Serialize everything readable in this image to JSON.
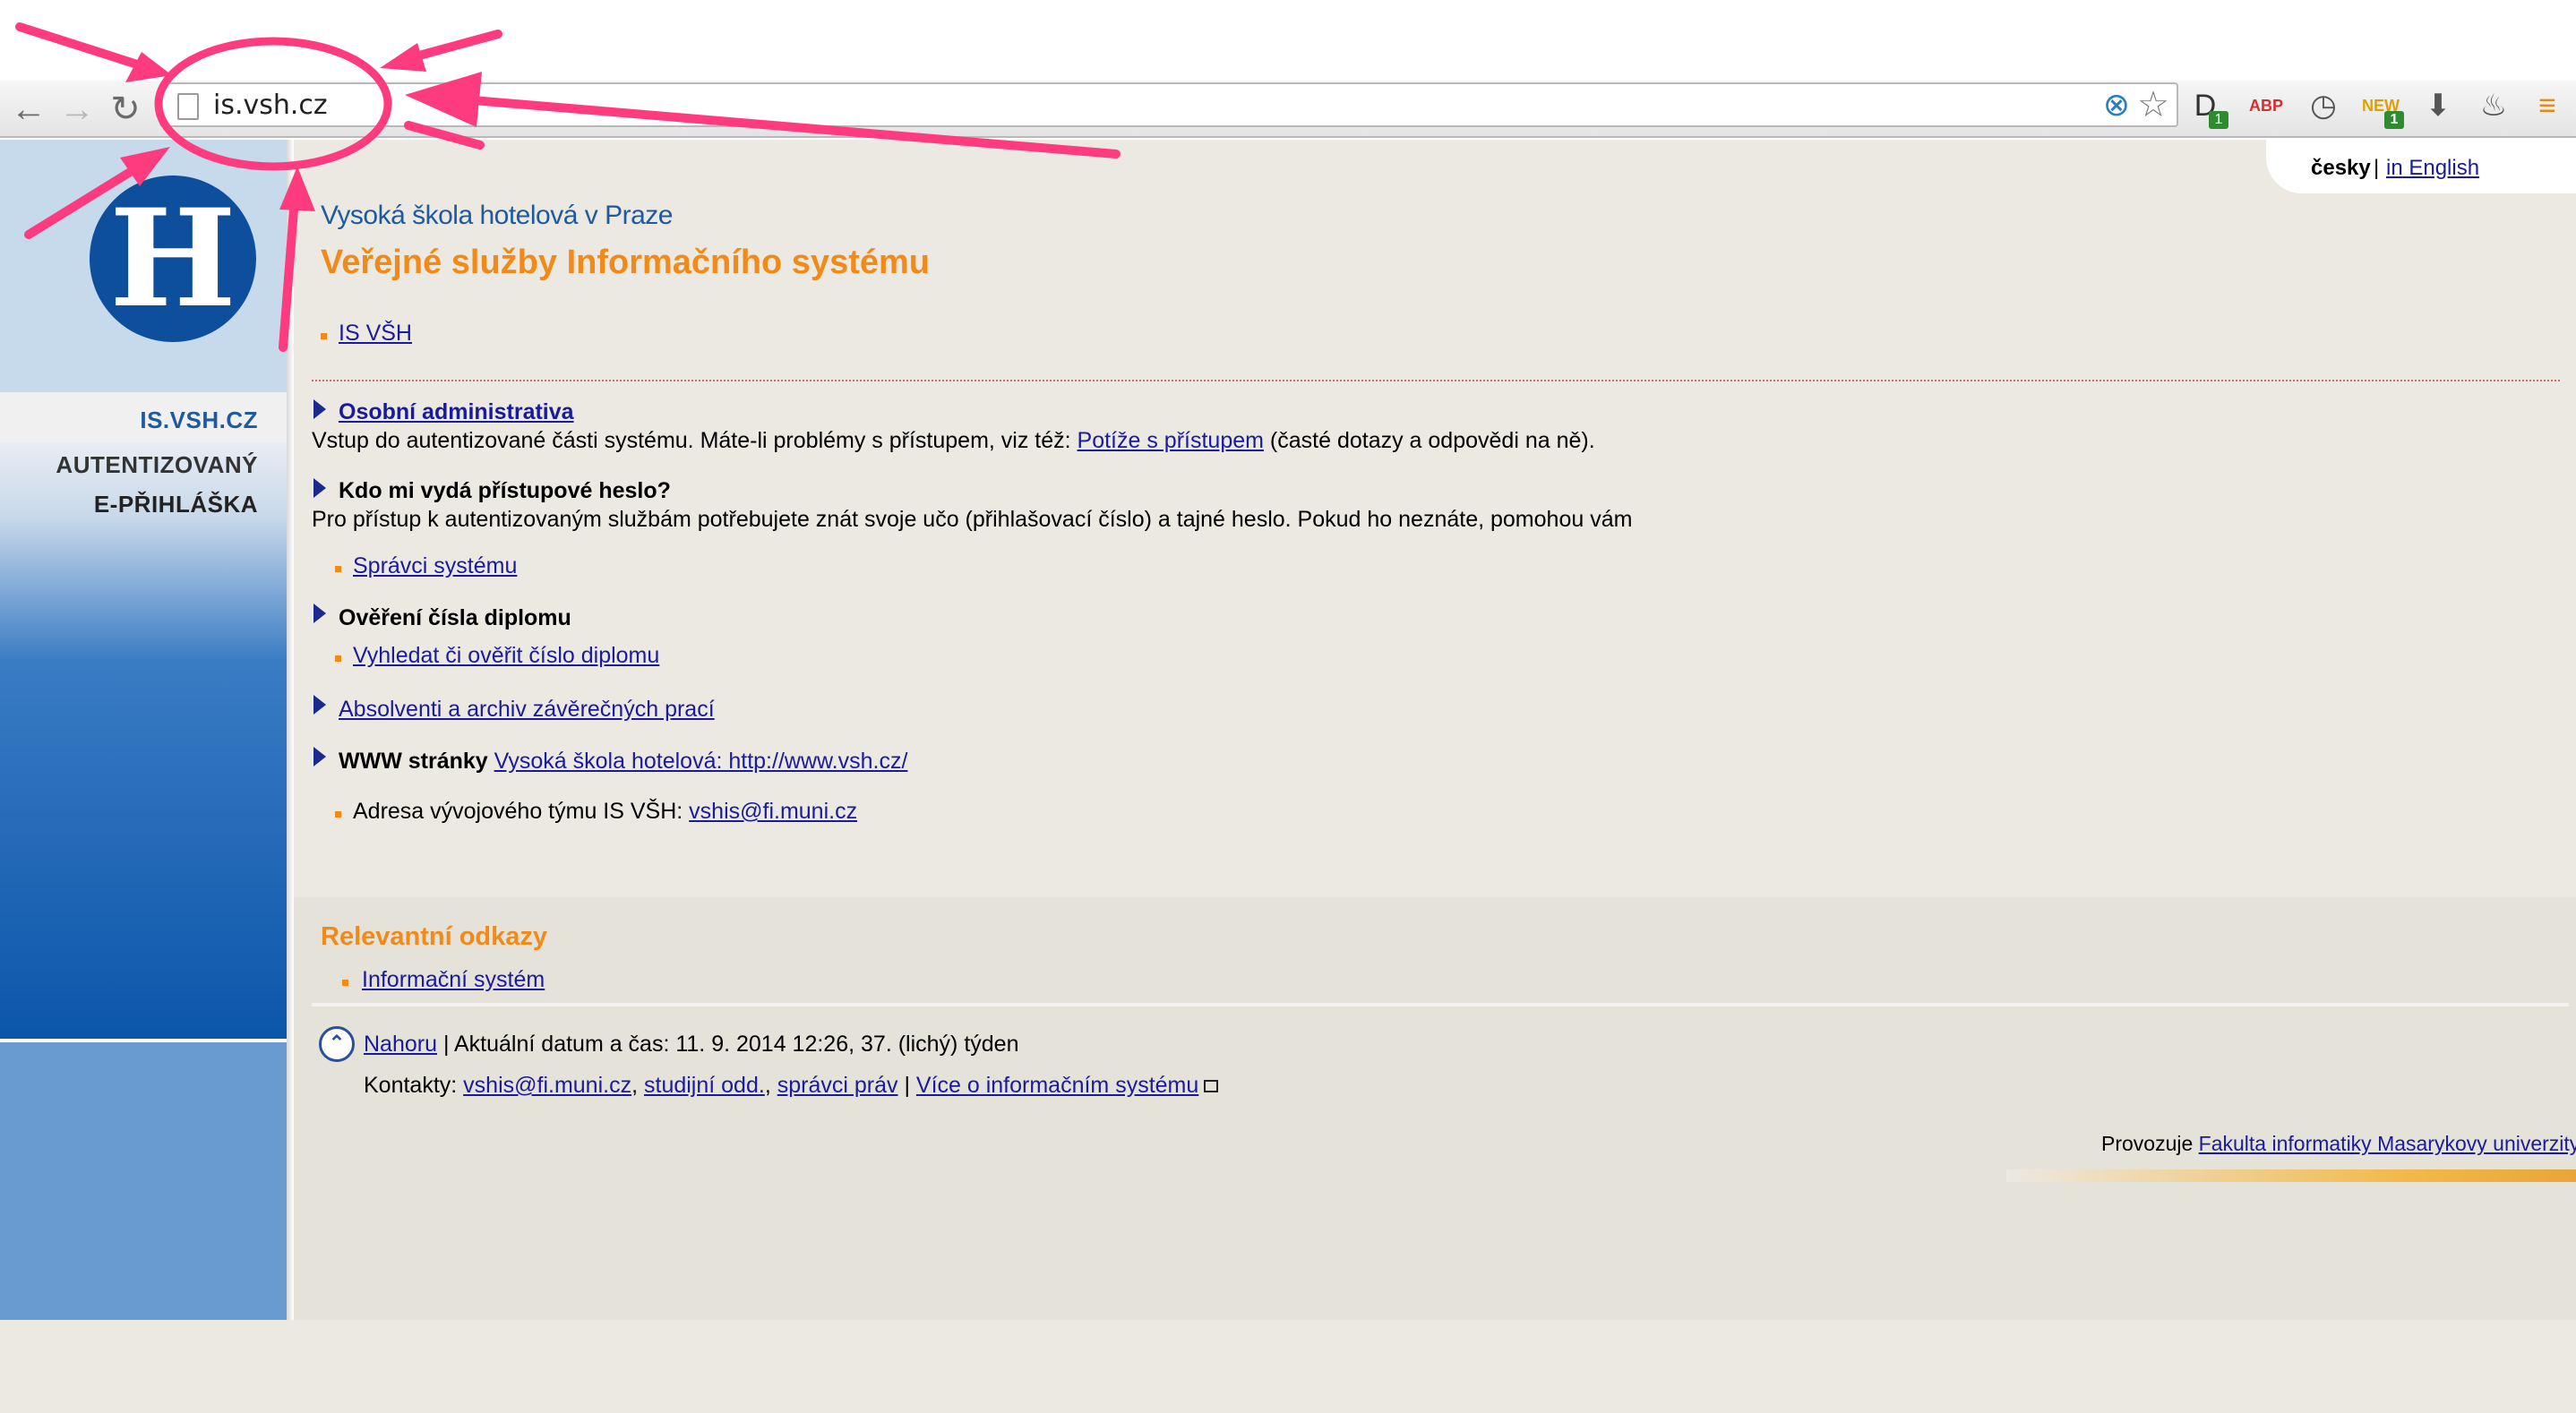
{
  "browser": {
    "url": "is.vsh.cz",
    "extensions": [
      {
        "name": "d-extension-icon",
        "glyph": "D",
        "badge": "1",
        "color": "#333333"
      },
      {
        "name": "adblock-icon",
        "glyph": "ABP",
        "badge": "",
        "color": "#d32f2f"
      },
      {
        "name": "clock-icon",
        "glyph": "◷",
        "badge": "",
        "color": "#555555"
      },
      {
        "name": "new-ext-icon",
        "glyph": "NEW",
        "badge": "1",
        "color": "#e0a000"
      },
      {
        "name": "download-icon",
        "glyph": "⬇",
        "badge": "",
        "color": "#555555"
      },
      {
        "name": "lamp-icon",
        "glyph": "♨",
        "badge": "",
        "color": "#555555"
      },
      {
        "name": "menu-icon",
        "glyph": "≡",
        "badge": "",
        "color": "#e08a1a"
      }
    ]
  },
  "lang": {
    "current": "česky",
    "separator": "|",
    "english": "in English"
  },
  "sidebar": {
    "items": [
      {
        "label": "IS.VSH.CZ",
        "color": "#1e5aa0"
      },
      {
        "label": "AUTENTIZOVANÝ",
        "color": "#333333"
      },
      {
        "label": "E-PŘIHLÁŠKA",
        "color": "#222222"
      }
    ]
  },
  "header": {
    "school": "Vysoká škola hotelová v Praze",
    "title": "Veřejné služby Informačního systému",
    "is_link": "IS VŠH"
  },
  "main": {
    "osobni": {
      "title": "Osobní administrativa",
      "desc_pre": "Vstup do autentizované části systému. Máte-li problémy s přístupem, viz též: ",
      "desc_link": "Potíže s přístupem",
      "desc_post": " (časté dotazy a odpovědi na ně)."
    },
    "heslo": {
      "title": "Kdo mi vydá přístupové heslo?",
      "desc": "Pro přístup k autentizovaným službám potřebujete znát svoje učo (přihlašovací číslo) a tajné heslo. Pokud ho neznáte, pomohou vám",
      "link": "Správci systému"
    },
    "diplom": {
      "title": "Ověření čísla diplomu",
      "link": "Vyhledat či ověřit číslo diplomu"
    },
    "absolventi": {
      "link": "Absolventi a archiv závěrečných prací"
    },
    "www": {
      "label": "WWW stránky",
      "link": "Vysoká škola hotelová: http://www.vsh.cz/"
    },
    "adresa": {
      "label": "Adresa vývojového týmu IS VŠH: ",
      "link": "vshis@fi.muni.cz"
    }
  },
  "relevant": {
    "title": "Relevantní odkazy",
    "link": "Informační systém"
  },
  "footer": {
    "up_link": "Nahoru",
    "date_text": " | Aktuální datum a čas: 11. 9. 2014 12:26, 37. (lichý) týden",
    "contacts_label": "Kontakty: ",
    "contact_email": "vshis@fi.muni.cz",
    "comma1": ", ",
    "contact_studijni": "studijní odd.",
    "comma2": ", ",
    "contact_spravci": "správci práv",
    "sep": " | ",
    "more_link": "Více o informačním systému",
    "provozuje": "Provozuje ",
    "provozuje_link": "Fakulta informatiky Masarykovy univerzity"
  },
  "colors": {
    "accent_orange": "#f28a1a",
    "link_blue": "#1a1a9c",
    "annotation_pink": "#ff3b7f"
  }
}
